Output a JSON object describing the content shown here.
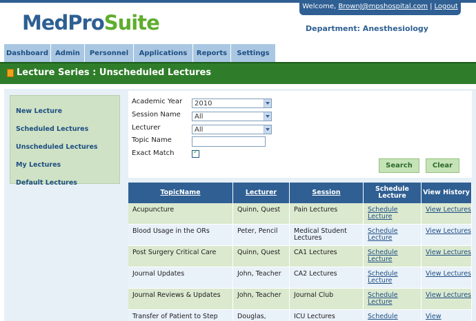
{
  "app": {
    "logo_part1": "MedPro",
    "logo_part2": "Suite"
  },
  "user": {
    "welcome_prefix": "Welcome, ",
    "email": "BrownJ@mpshospital.com",
    "logout": "Logout",
    "separator": "|"
  },
  "department": "Department: Anesthesiology",
  "nav": {
    "tabs": [
      "Dashboard",
      "Admin",
      "Personnel",
      "Applications",
      "Reports",
      "Settings"
    ]
  },
  "page": {
    "title": "Lecture Series : Unscheduled Lectures"
  },
  "sidebar": {
    "items": [
      "New Lecture",
      "Scheduled Lectures",
      "Unscheduled Lectures",
      "My Lectures",
      "Default Lectures"
    ]
  },
  "filters": {
    "academic_year": {
      "label": "Academic Year",
      "value": "2010"
    },
    "session_name": {
      "label": "Session Name",
      "value": "All"
    },
    "lecturer": {
      "label": "Lecturer",
      "value": "All"
    },
    "topic_name": {
      "label": "Topic Name",
      "value": ""
    },
    "exact_match": {
      "label": "Exact Match",
      "checked": true
    },
    "search_label": "Search",
    "clear_label": "Clear"
  },
  "table": {
    "headers": [
      "TopicName",
      "Lecturer",
      "Session",
      "Schedule Lecture",
      "View History"
    ],
    "rows": [
      {
        "topic": "Acupuncture",
        "lecturer": "Quinn, Quest",
        "session": "Pain Lectures",
        "schedule": "Schedule Lecture",
        "history": "View Lectures"
      },
      {
        "topic": "Blood Usage in the ORs",
        "lecturer": "Peter, Pencil",
        "session": "Medical Student Lectures",
        "schedule": "Schedule Lecture",
        "history": "View Lectures"
      },
      {
        "topic": "Post Surgery Critical Care",
        "lecturer": "Quinn, Quest",
        "session": "CA1 Lectures",
        "schedule": "Schedule Lecture",
        "history": "View Lectures"
      },
      {
        "topic": "Journal Updates",
        "lecturer": "John, Teacher",
        "session": "CA2 Lectures",
        "schedule": "Schedule Lecture",
        "history": "View Lectures"
      },
      {
        "topic": "Journal Reviews & Updates",
        "lecturer": "John, Teacher",
        "session": "Journal Club",
        "schedule": "Schedule Lecture",
        "history": "View Lectures"
      },
      {
        "topic": "Transfer of Patient to Step",
        "lecturer": "Douglas,",
        "session": "ICU Lectures",
        "schedule": "Schedule",
        "history": "View"
      }
    ]
  },
  "colors": {
    "brand_blue": "#2f5f93",
    "brand_green": "#5fad2e",
    "header_green": "#2f7d2a"
  }
}
